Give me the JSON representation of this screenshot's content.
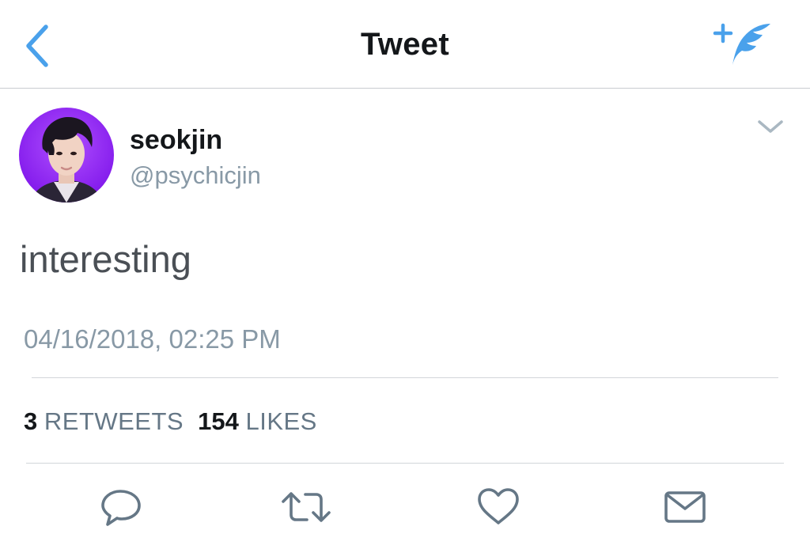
{
  "colors": {
    "accent": "#4aa1eb",
    "text_primary": "#14171a",
    "text_secondary": "#8899a6",
    "icon_gray": "#657786",
    "avatar_bg": "#8a1cf0"
  },
  "navbar": {
    "title": "Tweet",
    "back_icon": "chevron-left-icon",
    "compose_icon": "compose-tweet-icon"
  },
  "tweet": {
    "author": {
      "display_name": "seokjin",
      "handle": "@psychicjin"
    },
    "text": "interesting",
    "timestamp": "04/16/2018, 02:25 PM",
    "stats": {
      "retweets_count": "3",
      "retweets_label": "RETWEETS",
      "likes_count": "154",
      "likes_label": "LIKES"
    }
  },
  "actions": [
    {
      "name": "reply",
      "icon": "reply-icon"
    },
    {
      "name": "retweet",
      "icon": "retweet-icon"
    },
    {
      "name": "like",
      "icon": "heart-icon"
    },
    {
      "name": "direct-message",
      "icon": "envelope-icon"
    }
  ]
}
